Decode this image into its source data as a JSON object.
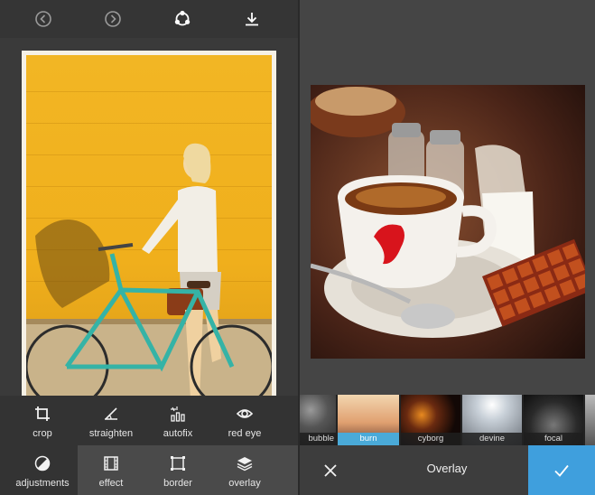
{
  "editor": {
    "tools": [
      {
        "label": "crop",
        "icon": "crop-icon"
      },
      {
        "label": "straighten",
        "icon": "straighten-icon"
      },
      {
        "label": "autofix",
        "icon": "autofix-icon"
      },
      {
        "label": "red eye",
        "icon": "red-eye-icon"
      },
      {
        "label": "adjustments",
        "icon": "adjustments-icon"
      },
      {
        "label": "effect",
        "icon": "effect-icon"
      },
      {
        "label": "border",
        "icon": "border-icon"
      },
      {
        "label": "overlay",
        "icon": "overlay-icon"
      }
    ],
    "toolbar_icons": [
      "undo-icon",
      "redo-icon",
      "share-icon",
      "download-icon"
    ]
  },
  "overlay_panel": {
    "title": "Overlay",
    "filters": [
      {
        "label": "bubble",
        "selected": false
      },
      {
        "label": "burn",
        "selected": true
      },
      {
        "label": "cyborg",
        "selected": false
      },
      {
        "label": "devine",
        "selected": false
      },
      {
        "label": "focal",
        "selected": false
      },
      {
        "label": "",
        "selected": false
      }
    ]
  },
  "colors": {
    "accent": "#3f9fdd",
    "selected_filter": "#4aaad8",
    "wall_yellow": "#f2b624"
  }
}
